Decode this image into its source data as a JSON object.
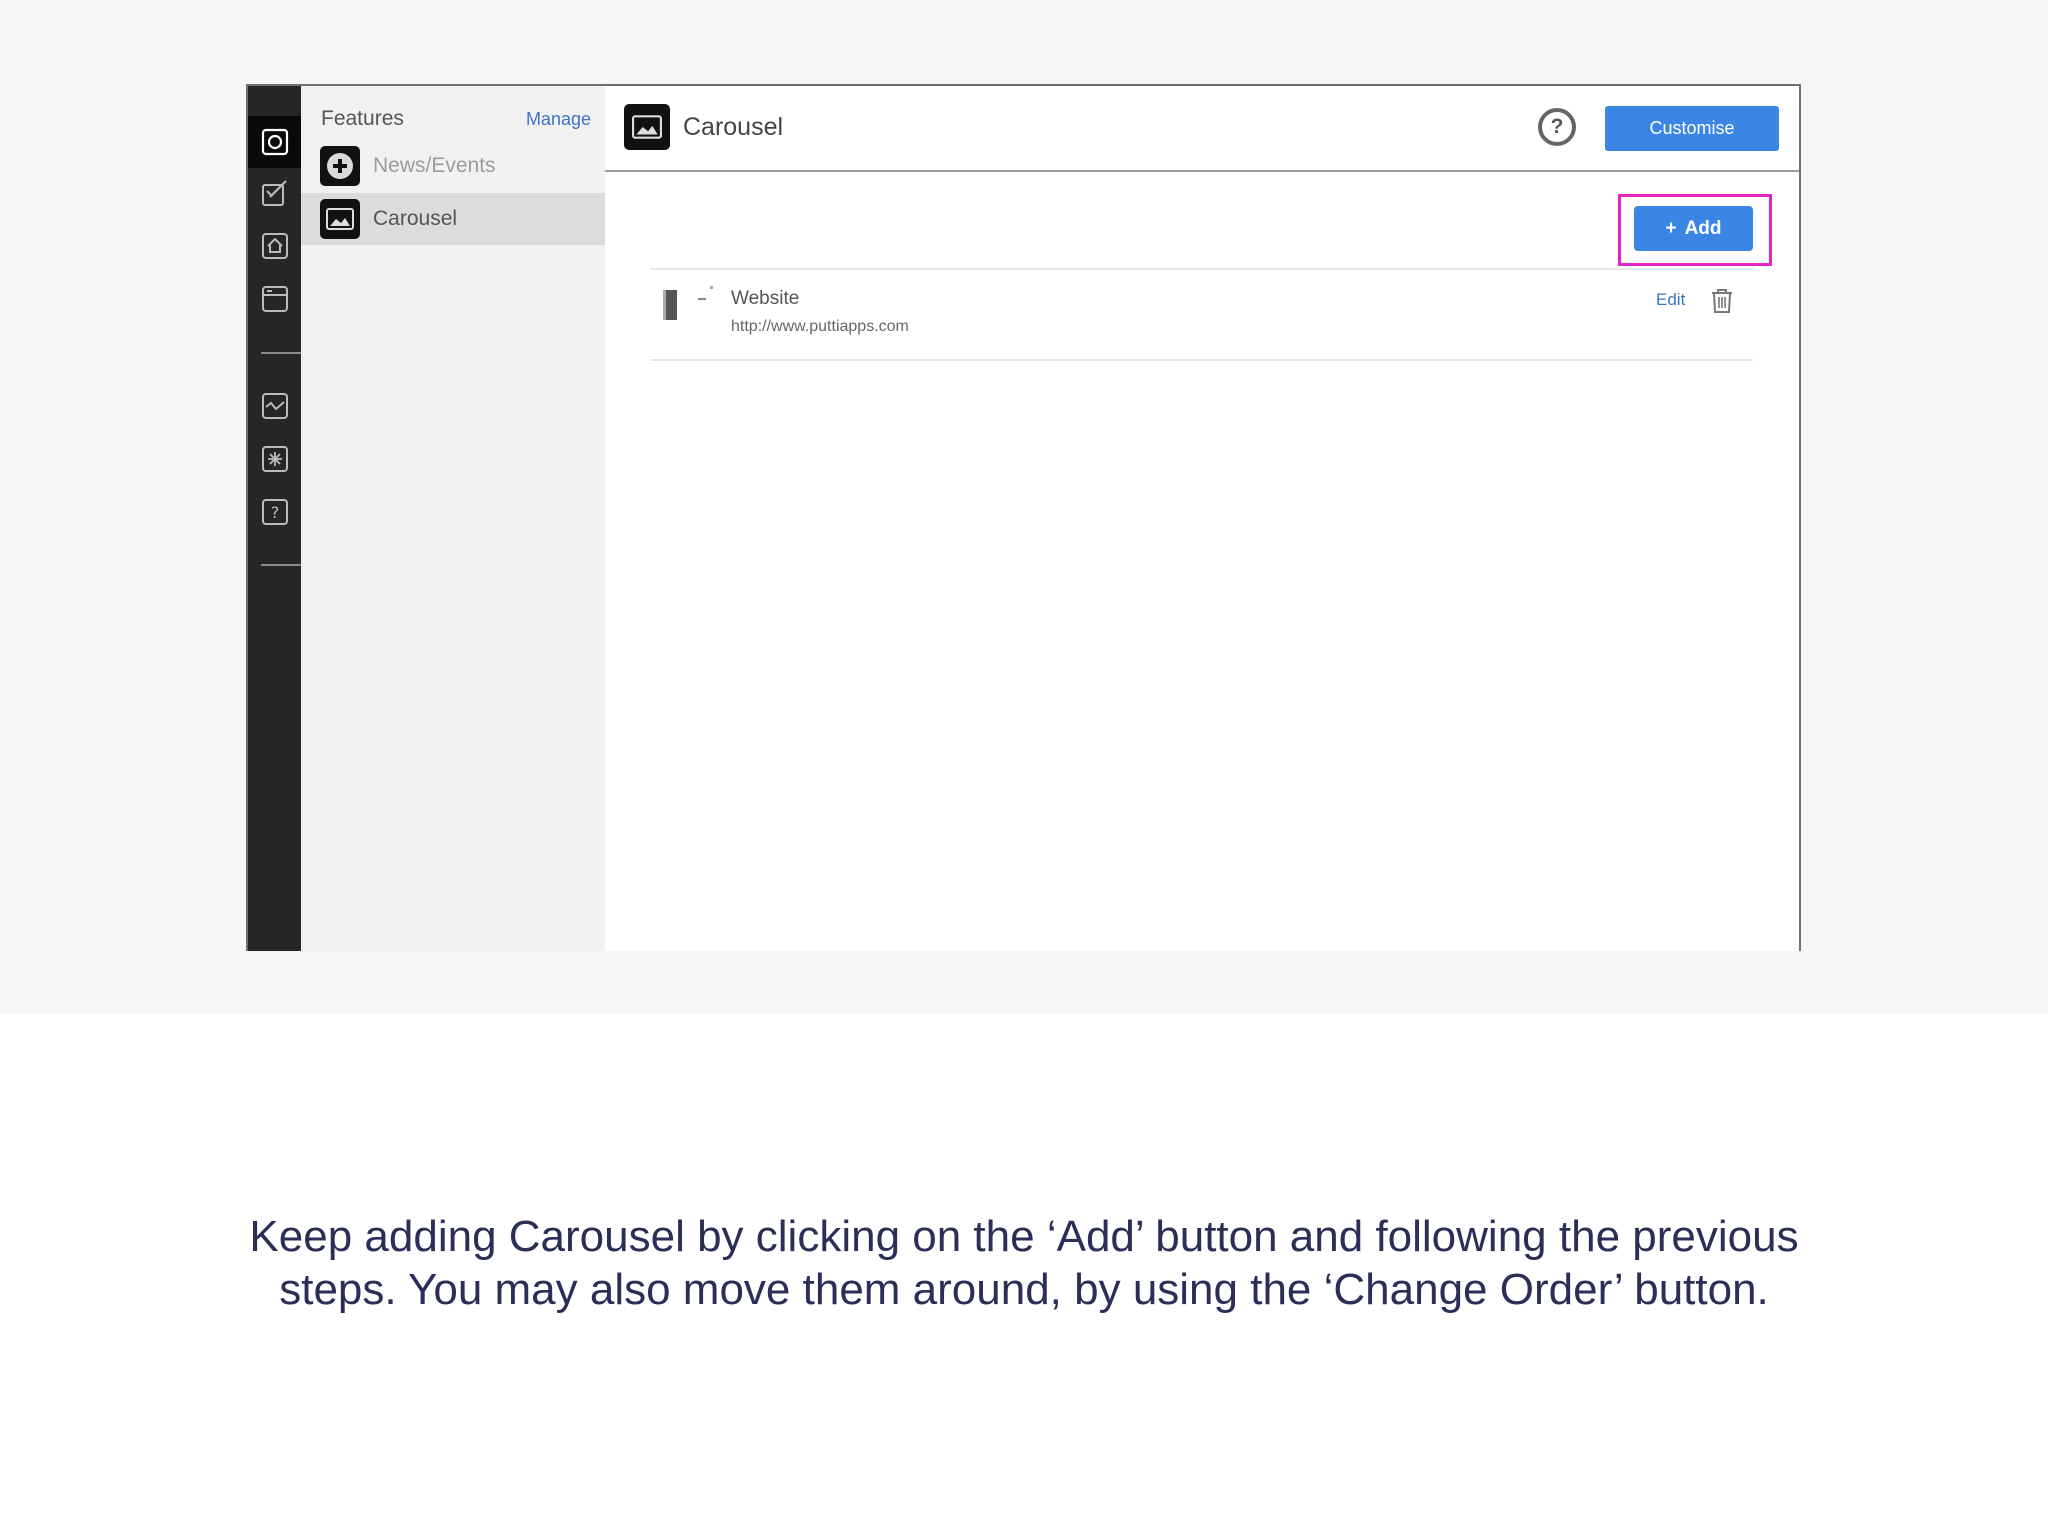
{
  "features_panel": {
    "title": "Features",
    "manage_label": "Manage",
    "items": [
      {
        "label": "News/Events",
        "icon": "plus-circle-icon",
        "selected": false
      },
      {
        "label": "Carousel",
        "icon": "image-icon",
        "selected": true
      }
    ]
  },
  "rail": {
    "items": [
      "camera-icon",
      "edit-icon",
      "home-icon",
      "layout-icon",
      "chart-icon",
      "settings-icon",
      "help-icon"
    ]
  },
  "main": {
    "title": "Carousel",
    "help_label": "?",
    "customise_label": "Customise",
    "add_label": "Add",
    "add_icon": "+",
    "items": [
      {
        "title": "Website",
        "url": "http://www.puttiapps.com",
        "edit_label": "Edit"
      }
    ]
  },
  "colors": {
    "accent_blue": "#3b86e4",
    "highlight_magenta": "#e424c7",
    "rail_dark": "#262626",
    "caption_text": "#2b2e56"
  },
  "caption": {
    "line1": "Keep adding Carousel by clicking on the ‘Add’ button and following the previous",
    "line2": "steps. You may also move them around, by using the ‘Change Order’ button."
  }
}
